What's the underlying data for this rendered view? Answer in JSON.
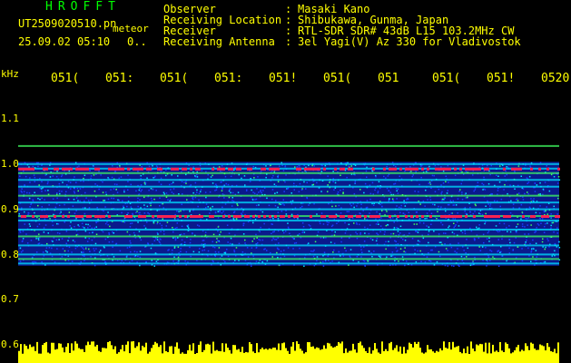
{
  "header": {
    "app_title": "HROFFT",
    "file_name": "UT2509020510.pn",
    "meteor_label": "meteor",
    "datetime": "25.09.02 05:10",
    "counter": "0.."
  },
  "info": {
    "colon": ":",
    "rows": [
      {
        "label": "Observer",
        "value": "Masaki Kano"
      },
      {
        "label": "Receiving Location",
        "value": "Shibukawa, Gunma, Japan"
      },
      {
        "label": "Receiver",
        "value": "RTL-SDR SDR# 43dB L15 103.2MHz CW"
      },
      {
        "label": "Receiving Antenna",
        "value": "3el Yagi(V) Az 330 for Vladivostok"
      }
    ]
  },
  "chart_data": {
    "type": "heatmap",
    "ylabel": "kHz",
    "y_ticks": [
      "1.1",
      "1.0",
      "0.9",
      "0.8",
      "0.7",
      "0.6"
    ],
    "y_range": [
      0.6,
      1.1
    ],
    "x_ticks": [
      "051(",
      "051:",
      "051(",
      "051:",
      "051!",
      "051(",
      "051",
      "051(",
      "051!",
      "0520"
    ],
    "bands_khz": [
      1.04,
      1.0,
      0.99,
      0.98,
      0.965,
      0.95,
      0.93,
      0.915,
      0.9,
      0.885,
      0.875,
      0.855,
      0.84,
      0.82,
      0.8,
      0.79,
      0.78
    ],
    "signal_range_khz": [
      0.775,
      1.005
    ],
    "palette": {
      "background": "#000000",
      "noise": "#1a3cff",
      "mid": "#00e0ff",
      "high": "#40ff60",
      "peak": "#ff2050",
      "level_bar": "#ffff00"
    }
  }
}
